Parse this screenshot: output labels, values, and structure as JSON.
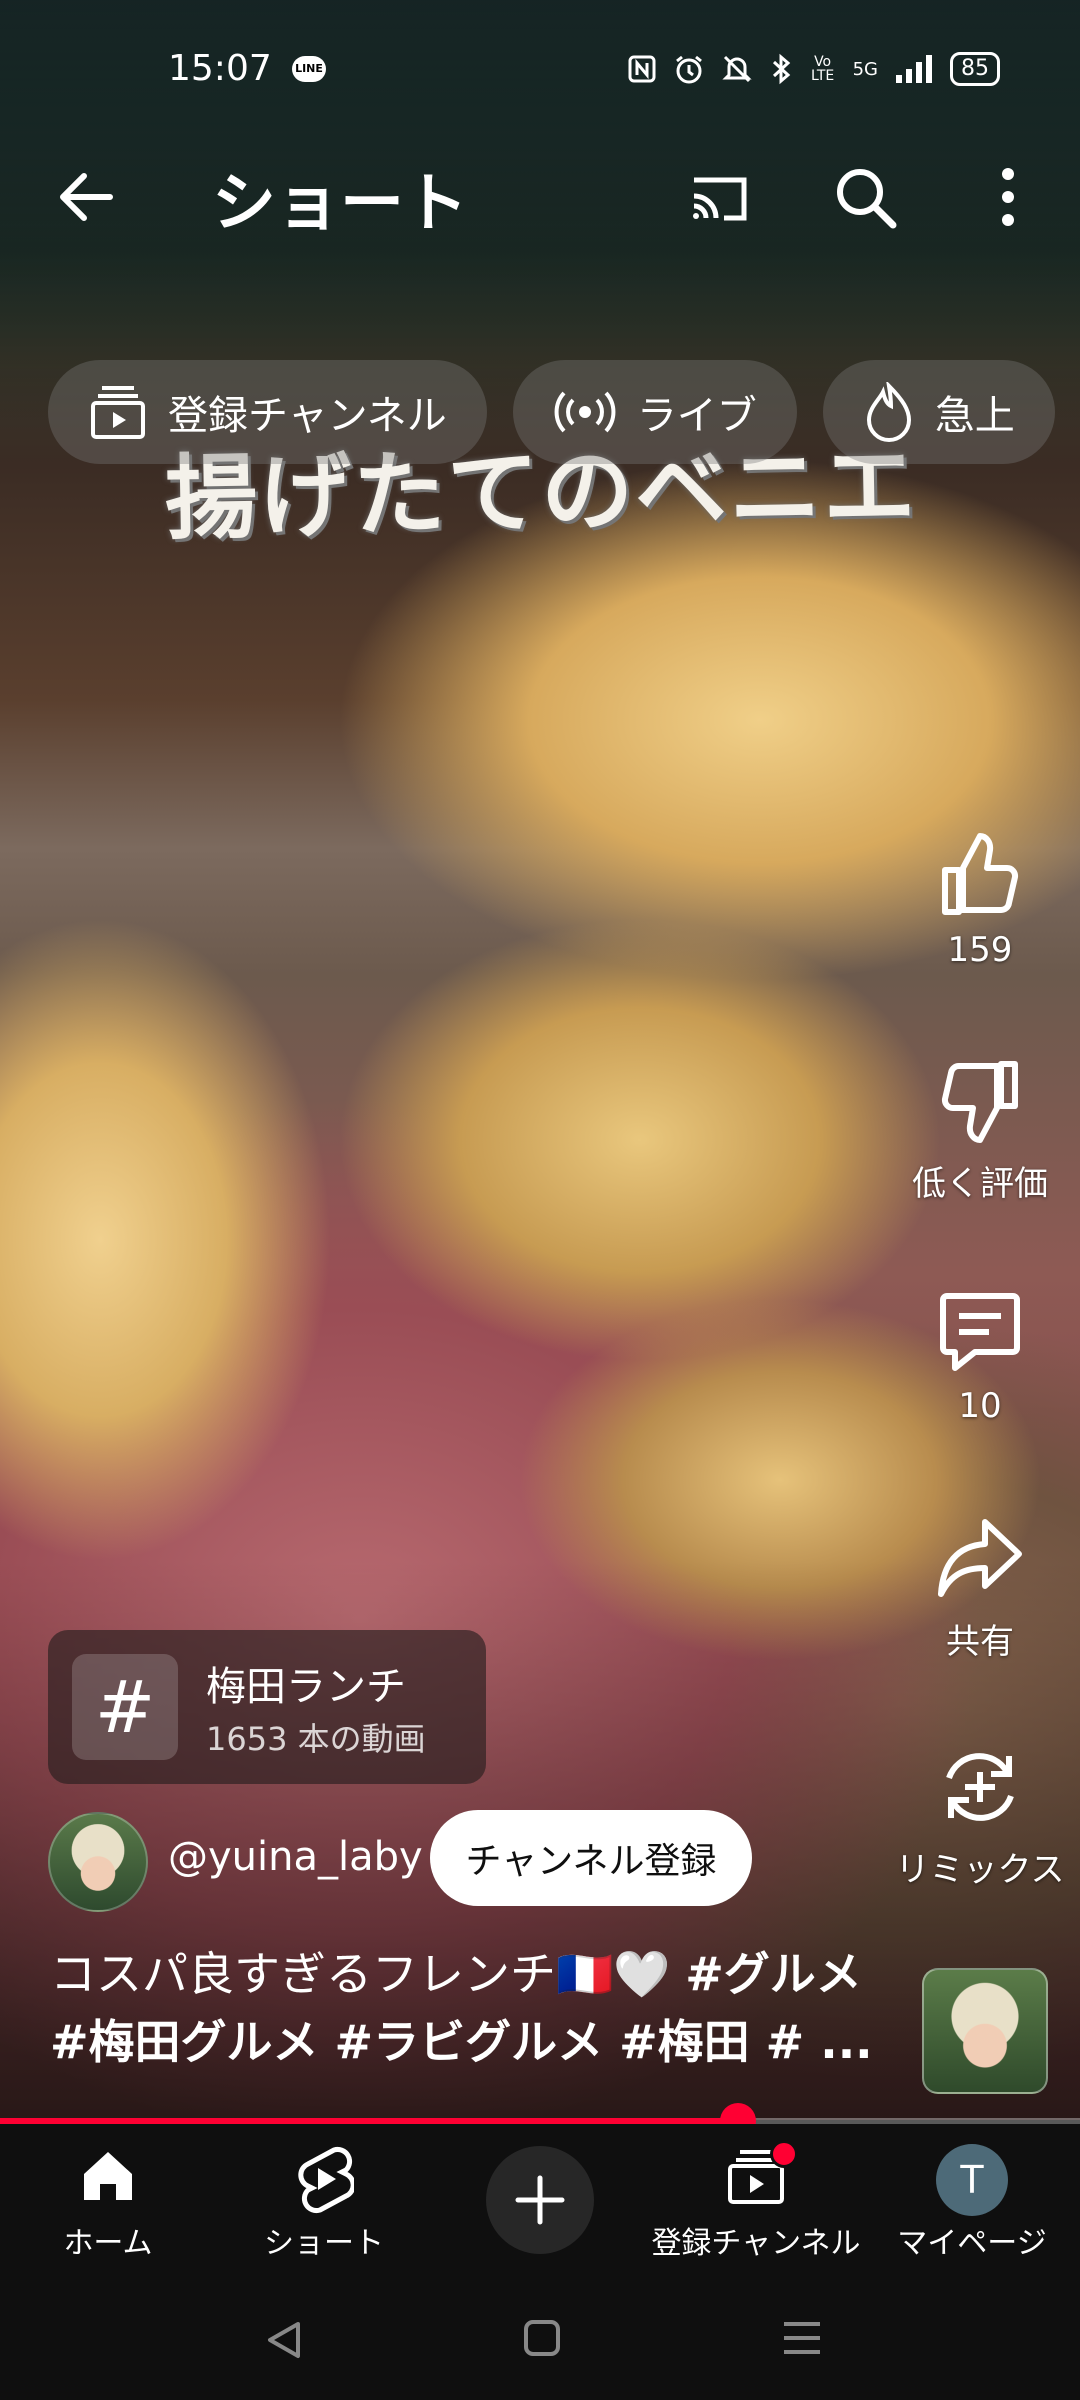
{
  "status_bar": {
    "time": "15:07",
    "line_badge": "LINE",
    "network": "5G",
    "volte": "Vo LTE",
    "battery": "85"
  },
  "video_overlay": {
    "caption": "揚げたてのベニエ"
  },
  "app_bar": {
    "title": "ショート"
  },
  "chips": [
    {
      "label": "登録チャンネル"
    },
    {
      "label": "ライブ"
    },
    {
      "label": "急上"
    }
  ],
  "actions": {
    "like_count": "159",
    "dislike_label": "低く評価",
    "comment_count": "10",
    "share_label": "共有",
    "remix_label": "リミックス"
  },
  "hashtag_card": {
    "symbol": "#",
    "name": "梅田ランチ",
    "count": "1653 本の動画"
  },
  "channel": {
    "handle": "@yuina_laby",
    "subscribe_label": "チャンネル登録"
  },
  "description": {
    "line1_plain": "コスパ良すぎるフレンチ🇫🇷🤍 ",
    "line1_tag": "#グルメ",
    "line2": "#梅田グルメ #ラビグルメ #梅田 # ..."
  },
  "progress": {
    "fraction": 0.683
  },
  "bottom_nav": {
    "home": "ホーム",
    "shorts": "ショート",
    "subscriptions": "登録チャンネル",
    "mypage": "マイページ",
    "avatar_initial": "T"
  },
  "colors": {
    "accent": "#ff0033",
    "nav_bg": "#0f0f0f"
  }
}
